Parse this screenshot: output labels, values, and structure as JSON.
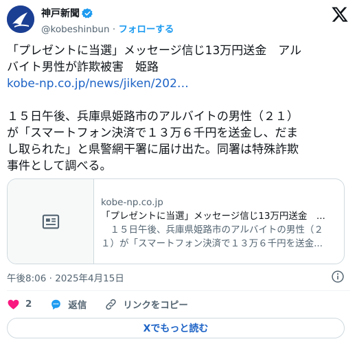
{
  "account": {
    "name": "神戸新聞",
    "handle": "@kobeshinbun",
    "separator": " · ",
    "follow_label": "フォローする"
  },
  "tweet": {
    "line1": "「プレゼントに当選」メッセージ信じ13万円送金　アル",
    "line2": "バイト男性が詐欺被害　姫路",
    "link": "kobe-np.co.jp/news/jiken/202…",
    "body1": "１５日午後、兵庫県姫路市のアルバイトの男性（２１）",
    "body2": "が「スマートフォン決済で１３万６千円を送金し、だま",
    "body3": "し取られた」と県警網干署に届け出た。同署は特殊詐欺",
    "body4": "事件として調べる。"
  },
  "card": {
    "domain": "kobe-np.co.jp",
    "title": "「プレゼントに当選」メッセージ信じ13万円送金　...",
    "desc1": "　１５日午後、兵庫県姫路市のアルバイトの男性（２",
    "desc2": "１）が「スマートフォン決済で１３万６千円を送金..."
  },
  "meta": {
    "timestamp": "午後8:06 · 2025年4月15日"
  },
  "actions": {
    "likes": "2",
    "reply_label": "返信",
    "copy_link_label": "リンクをコピー"
  },
  "read_more": "Xでもっと読む",
  "colors": {
    "accent": "#1d9bf0",
    "link": "#1d63c6",
    "like": "#f91880",
    "muted": "#536471"
  },
  "icons": [
    "x-logo-icon",
    "verified-badge-icon",
    "article-icon",
    "info-icon",
    "heart-icon",
    "reply-icon",
    "link-icon"
  ]
}
